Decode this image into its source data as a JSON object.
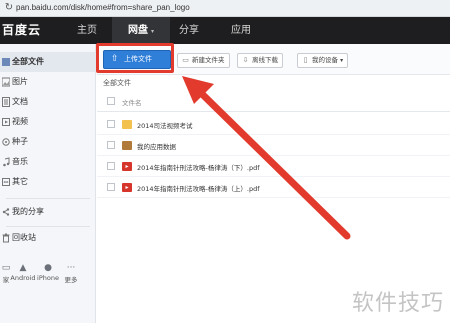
{
  "browser": {
    "url": "pan.baidu.com/disk/home#from=share_pan_logo",
    "reload_icon": "reload-icon"
  },
  "topnav": {
    "logo": "百度云",
    "items": [
      {
        "label": "主页"
      },
      {
        "label": "网盘",
        "caret": "▾"
      },
      {
        "label": "分享"
      },
      {
        "label": "应用"
      }
    ]
  },
  "sidebar": {
    "items": [
      {
        "label": "全部文件",
        "icon": "all-files-icon"
      },
      {
        "label": "图片",
        "icon": "image-icon"
      },
      {
        "label": "文档",
        "icon": "document-icon"
      },
      {
        "label": "视频",
        "icon": "video-icon"
      },
      {
        "label": "种子",
        "icon": "torrent-icon"
      },
      {
        "label": "音乐",
        "icon": "music-icon"
      },
      {
        "label": "其它",
        "icon": "other-icon"
      },
      {
        "label": "我的分享",
        "icon": "share-icon"
      },
      {
        "label": "回收站",
        "icon": "recycle-bin-icon"
      }
    ],
    "devices": [
      {
        "label": "家"
      },
      {
        "label": "Android"
      },
      {
        "label": "iPhone"
      },
      {
        "label": "更多"
      }
    ]
  },
  "toolbar": {
    "upload_label": "上传文件",
    "new_folder_label": "新建文件夹",
    "offline_download_label": "离线下载",
    "my_devices_label": "我的设备"
  },
  "breadcrumb": "全部文件",
  "list": {
    "column_name": "文件名",
    "files": [
      {
        "name": "2014司法视频考试",
        "type": "folder"
      },
      {
        "name": "我的应用数据",
        "type": "app-data"
      },
      {
        "name": "2014年指南针刑法攻略-杨律涛（下）.pdf",
        "type": "pdf"
      },
      {
        "name": "2014年指南针刑法攻略-杨律涛（上）.pdf",
        "type": "pdf"
      }
    ]
  },
  "watermark": "软件技巧",
  "colors": {
    "accent": "#2f7ed8",
    "highlight": "#e23b2e",
    "topnav": "#1e1e20"
  }
}
